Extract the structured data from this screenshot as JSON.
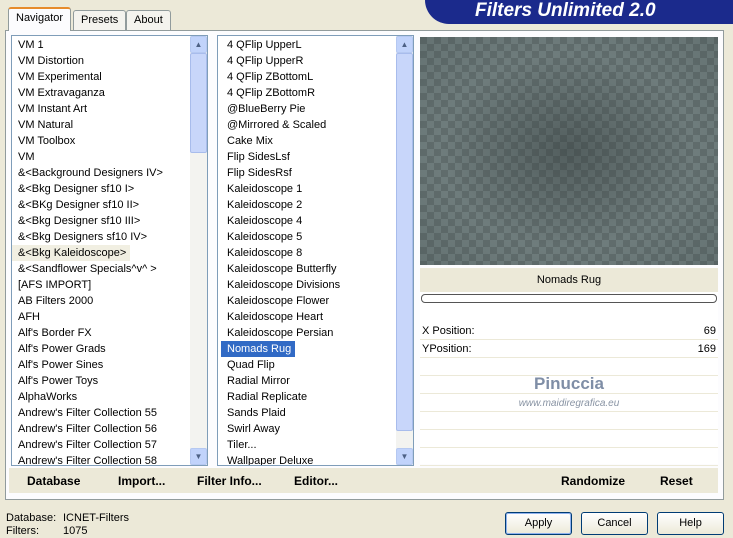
{
  "banner_title": "Filters Unlimited 2.0",
  "tabs": [
    {
      "label": "Navigator"
    },
    {
      "label": "Presets"
    },
    {
      "label": "About"
    }
  ],
  "categories": [
    {
      "label": "VM 1"
    },
    {
      "label": "VM Distortion"
    },
    {
      "label": "VM Experimental"
    },
    {
      "label": "VM Extravaganza"
    },
    {
      "label": "VM Instant Art"
    },
    {
      "label": "VM Natural"
    },
    {
      "label": "VM Toolbox"
    },
    {
      "label": "VM"
    },
    {
      "label": "&<Background Designers IV>"
    },
    {
      "label": "&<Bkg Designer sf10 I>"
    },
    {
      "label": "&<BKg Designer sf10 II>"
    },
    {
      "label": "&<Bkg Designer sf10 III>"
    },
    {
      "label": "&<Bkg Designers sf10 IV>"
    },
    {
      "label": "&<Bkg Kaleidoscope>"
    },
    {
      "label": "&<Sandflower Specials^v^ >"
    },
    {
      "label": "[AFS IMPORT]"
    },
    {
      "label": "AB Filters 2000"
    },
    {
      "label": "AFH"
    },
    {
      "label": "Alf's Border FX"
    },
    {
      "label": "Alf's Power Grads"
    },
    {
      "label": "Alf's Power Sines"
    },
    {
      "label": "Alf's Power Toys"
    },
    {
      "label": "AlphaWorks"
    },
    {
      "label": "Andrew's Filter Collection 55"
    },
    {
      "label": "Andrew's Filter Collection 56"
    },
    {
      "label": "Andrew's Filter Collection 57"
    },
    {
      "label": "Andrew's Filter Collection 58"
    }
  ],
  "filters": [
    {
      "label": "4 QFlip UpperL"
    },
    {
      "label": "4 QFlip UpperR"
    },
    {
      "label": "4 QFlip ZBottomL"
    },
    {
      "label": "4 QFlip ZBottomR"
    },
    {
      "label": "@BlueBerry Pie"
    },
    {
      "label": "@Mirrored & Scaled"
    },
    {
      "label": "Cake Mix"
    },
    {
      "label": "Flip SidesLsf"
    },
    {
      "label": "Flip SidesRsf"
    },
    {
      "label": "Kaleidoscope 1"
    },
    {
      "label": "Kaleidoscope 2"
    },
    {
      "label": "Kaleidoscope 4"
    },
    {
      "label": "Kaleidoscope 5"
    },
    {
      "label": "Kaleidoscope 8"
    },
    {
      "label": "Kaleidoscope Butterfly"
    },
    {
      "label": "Kaleidoscope Divisions"
    },
    {
      "label": "Kaleidoscope Flower"
    },
    {
      "label": "Kaleidoscope Heart"
    },
    {
      "label": "Kaleidoscope Persian"
    },
    {
      "label": "Nomads Rug"
    },
    {
      "label": "Quad Flip"
    },
    {
      "label": "Radial Mirror"
    },
    {
      "label": "Radial Replicate"
    },
    {
      "label": "Sands Plaid"
    },
    {
      "label": "Swirl Away"
    },
    {
      "label": "Tiler..."
    },
    {
      "label": "Wallpaper Deluxe"
    }
  ],
  "selected_category_index": 13,
  "selected_filter_index": 19,
  "filter_name": "Nomads Rug",
  "params": [
    {
      "label": "X Position:",
      "value": "69"
    },
    {
      "label": "YPosition:",
      "value": "169"
    }
  ],
  "watermark": {
    "line1": "Pinuccia",
    "line2": "www.maidiregrafica.eu"
  },
  "bottom_links": {
    "database": "Database",
    "import": "Import...",
    "filter_info": "Filter Info...",
    "editor": "Editor..."
  },
  "param_buttons": {
    "randomize": "Randomize",
    "reset": "Reset"
  },
  "status": {
    "database_label": "Database:",
    "database_value": "ICNET-Filters",
    "filters_label": "Filters:",
    "filters_value": "1075"
  },
  "dialog_buttons": {
    "apply": "Apply",
    "cancel": "Cancel",
    "help": "Help"
  }
}
